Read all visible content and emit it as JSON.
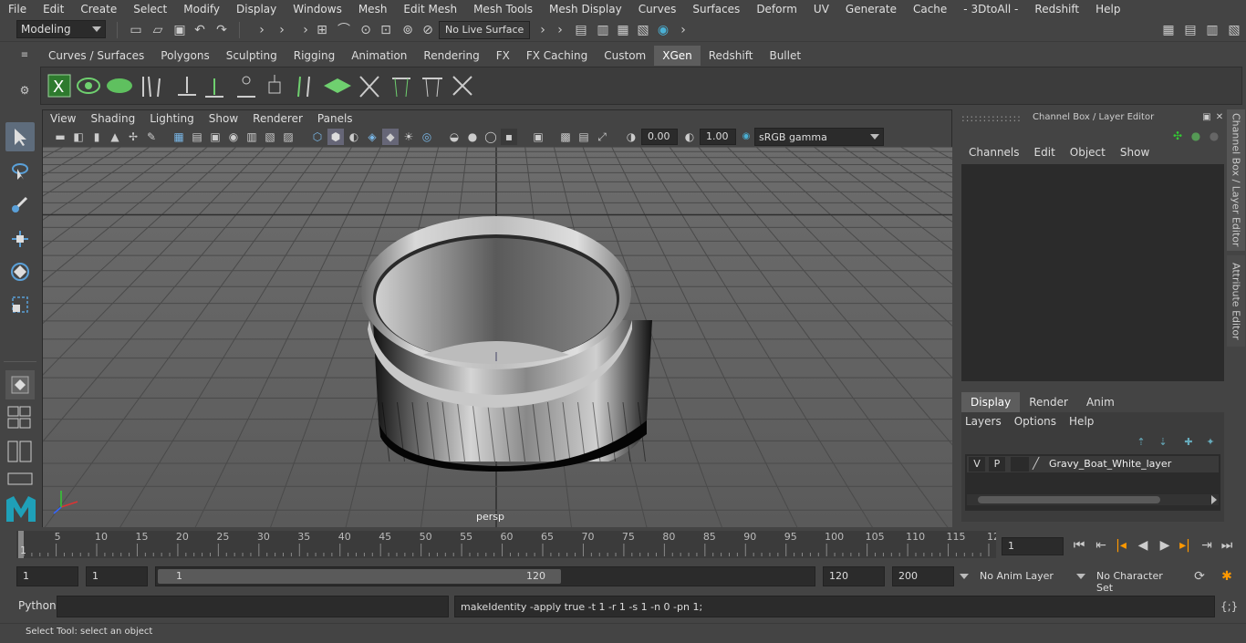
{
  "menu": [
    "File",
    "Edit",
    "Create",
    "Select",
    "Modify",
    "Display",
    "Windows",
    "Mesh",
    "Edit Mesh",
    "Mesh Tools",
    "Mesh Display",
    "Curves",
    "Surfaces",
    "Deform",
    "UV",
    "Generate",
    "Cache",
    "- 3DtoAll -",
    "Redshift",
    "Help"
  ],
  "status": {
    "mode": "Modeling",
    "live_surface": "No Live Surface"
  },
  "shelf_tabs": [
    "Curves / Surfaces",
    "Polygons",
    "Sculpting",
    "Rigging",
    "Animation",
    "Rendering",
    "FX",
    "FX Caching",
    "Custom",
    "XGen",
    "Redshift",
    "Bullet"
  ],
  "shelf_active": "XGen",
  "viewport": {
    "menu": [
      "View",
      "Shading",
      "Lighting",
      "Show",
      "Renderer",
      "Panels"
    ],
    "exposure": "0.00",
    "gamma": "1.00",
    "colorspace": "sRGB gamma",
    "camera_label": "persp"
  },
  "channel_box": {
    "title": "Channel Box / Layer Editor",
    "menu": [
      "Channels",
      "Edit",
      "Object",
      "Show"
    ]
  },
  "layer_editor": {
    "tabs": [
      "Display",
      "Render",
      "Anim"
    ],
    "active_tab": "Display",
    "menu": [
      "Layers",
      "Options",
      "Help"
    ],
    "layer": {
      "v": "V",
      "p": "P",
      "name": "Gravy_Boat_White_layer"
    }
  },
  "side_tabs": [
    "Channel Box / Layer Editor",
    "Attribute Editor"
  ],
  "timeline": {
    "ticks": [
      "5",
      "10",
      "15",
      "20",
      "25",
      "30",
      "35",
      "40",
      "45",
      "50",
      "55",
      "60",
      "65",
      "70",
      "75",
      "80",
      "85",
      "90",
      "95",
      "100",
      "105",
      "110",
      "115",
      "12"
    ],
    "start_marker": "1",
    "current_frame": "1"
  },
  "range": {
    "start": "1",
    "inner_start": "1",
    "slider_start": "1",
    "slider_end": "120",
    "end": "120",
    "max": "200",
    "anim_layer": "No Anim Layer",
    "char_set": "No Character Set"
  },
  "cmd": {
    "lang": "Python",
    "result": "makeIdentity -apply true -t 1 -r 1 -s 1 -n 0 -pn 1;"
  },
  "help_line": "Select Tool: select an object",
  "colors": {
    "bg": "#444444",
    "field": "#2b2b2b",
    "accent": "#5d5d5d",
    "active_tool": "#5e6c7c"
  }
}
